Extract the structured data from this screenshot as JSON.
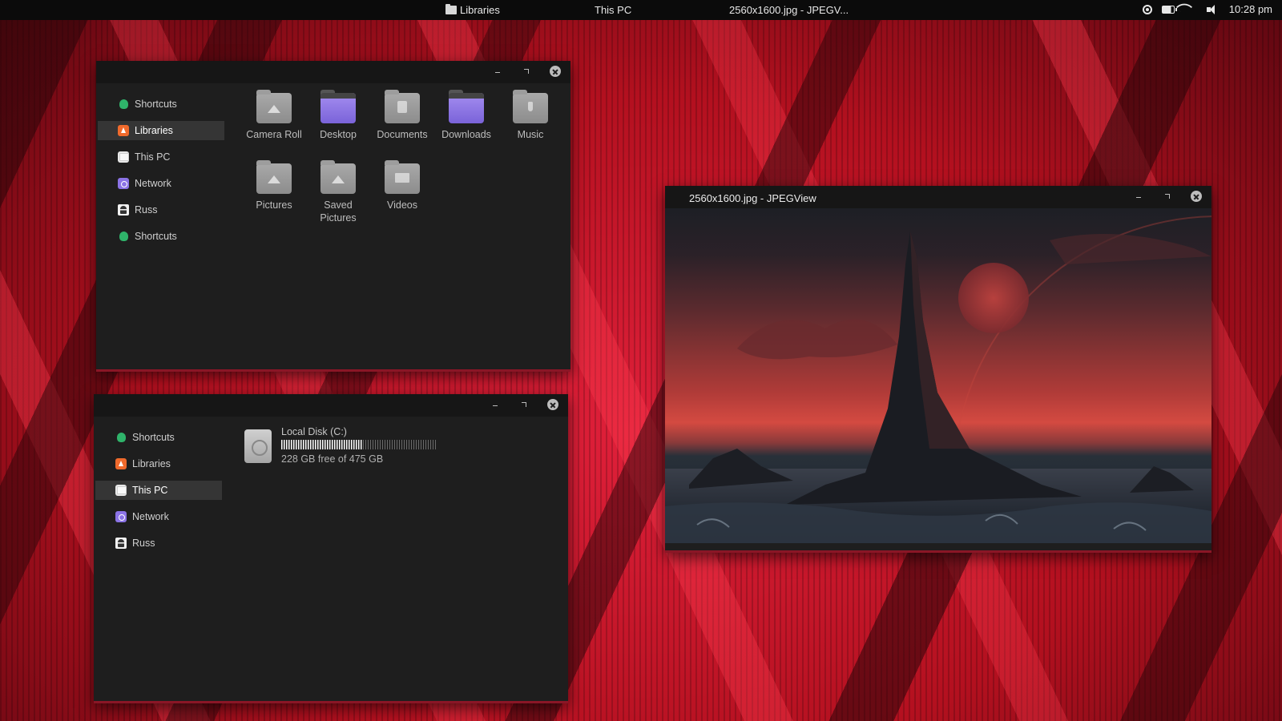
{
  "topbar": {
    "items": [
      {
        "label": "Libraries"
      },
      {
        "label": "This PC"
      },
      {
        "label": "2560x1600.jpg - JPEGV..."
      }
    ],
    "time": "10:28 pm"
  },
  "explorer1": {
    "sidebar": [
      {
        "label": "Shortcuts",
        "icon": "shortcut-icon",
        "active": false
      },
      {
        "label": "Libraries",
        "icon": "libraries-icon",
        "active": true
      },
      {
        "label": "This PC",
        "icon": "this-pc-icon",
        "active": false
      },
      {
        "label": "Network",
        "icon": "network-icon",
        "active": false
      },
      {
        "label": "Russ",
        "icon": "user-icon",
        "active": false
      },
      {
        "label": "Shortcuts",
        "icon": "shortcut-icon",
        "active": false
      }
    ],
    "folders": [
      {
        "label": "Camera Roll",
        "icon": "camera-roll-folder-icon",
        "color": "grey"
      },
      {
        "label": "Desktop",
        "icon": "desktop-folder-icon",
        "color": "purple"
      },
      {
        "label": "Documents",
        "icon": "documents-folder-icon",
        "color": "grey"
      },
      {
        "label": "Downloads",
        "icon": "downloads-folder-icon",
        "color": "purple"
      },
      {
        "label": "Music",
        "icon": "music-folder-icon",
        "color": "grey"
      },
      {
        "label": "Pictures",
        "icon": "pictures-folder-icon",
        "color": "grey"
      },
      {
        "label": "Saved Pictures",
        "icon": "saved-pictures-folder-icon",
        "color": "grey"
      },
      {
        "label": "Videos",
        "icon": "videos-folder-icon",
        "color": "grey"
      }
    ]
  },
  "explorer2": {
    "sidebar": [
      {
        "label": "Shortcuts",
        "icon": "shortcut-icon",
        "active": false
      },
      {
        "label": "Libraries",
        "icon": "libraries-icon",
        "active": false
      },
      {
        "label": "This PC",
        "icon": "this-pc-icon",
        "active": true
      },
      {
        "label": "Network",
        "icon": "network-icon",
        "active": false
      },
      {
        "label": "Russ",
        "icon": "user-icon",
        "active": false
      }
    ],
    "drive": {
      "name": "Local Disk (C:)",
      "free_text": "228 GB free of 475 GB",
      "used_fraction": 0.52
    }
  },
  "viewer": {
    "title": "2560x1600.jpg - JPEGView"
  },
  "colors": {
    "accent": "#8a1626",
    "window_bg": "#1e1e1e",
    "titlebar_bg": "#161616",
    "selection_bg": "#353535",
    "purple_folder": "#8b73e6"
  }
}
